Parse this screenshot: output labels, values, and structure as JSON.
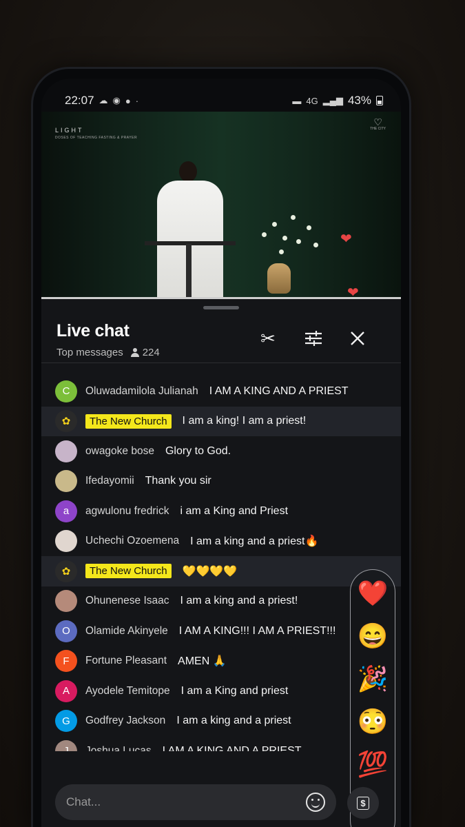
{
  "status": {
    "time": "22:07",
    "net": "4G",
    "battery": "43%"
  },
  "video": {
    "logo": "LIGHT",
    "logo_sub": "DOSES OF TEACHING FASTING & PRAYER",
    "corner_logo": "THE CITY"
  },
  "chat": {
    "title": "Live chat",
    "mode": "Top messages",
    "viewers": "224",
    "input_placeholder": "Chat...",
    "money_label": "$",
    "messages": [
      {
        "author": "Oluwadamilola Julianah",
        "text": "I AM A KING AND A PRIEST",
        "initial": "C",
        "color": "#7cbf3a",
        "owner": false
      },
      {
        "author": "The New Church",
        "text": "I am a king! I am a priest!",
        "initial": "✿",
        "color": "#2a2a2a",
        "owner": true
      },
      {
        "author": "owagoke bose",
        "text": "Glory to God.",
        "initial": "",
        "color": "#c7b4c9",
        "owner": false
      },
      {
        "author": "Ifedayomii",
        "text": "Thank you sir",
        "initial": "",
        "color": "#c9b98a",
        "owner": false
      },
      {
        "author": "agwulonu fredrick",
        "text": "i am a King and Priest",
        "initial": "a",
        "color": "#8e44c9",
        "owner": false
      },
      {
        "author": "Uchechi Ozoemena",
        "text": "I am a king and a priest🔥",
        "initial": "",
        "color": "#e0d6cf",
        "owner": false
      },
      {
        "author": "The New Church",
        "text": "💛💛💛💛",
        "initial": "✿",
        "color": "#2a2a2a",
        "owner": true
      },
      {
        "author": "Ohunenese Isaac",
        "text": "I am a king and a priest!",
        "initial": "",
        "color": "#b58a7a",
        "owner": false
      },
      {
        "author": "Olamide Akinyele",
        "text": "I AM A KING!!! I AM A PRIEST!!!",
        "initial": "O",
        "color": "#5c6bc0",
        "owner": false
      },
      {
        "author": "Fortune Pleasant",
        "text": "AMEN 🙏",
        "initial": "F",
        "color": "#f4511e",
        "owner": false
      },
      {
        "author": "Ayodele Temitope",
        "text": "I am a King and priest",
        "initial": "A",
        "color": "#d81b60",
        "owner": false
      },
      {
        "author": "Godfrey Jackson",
        "text": "I am a king and a priest",
        "initial": "G",
        "color": "#039be5",
        "owner": false
      },
      {
        "author": "Joshua Lucas",
        "text": "I AM A KING AND A PRIEST",
        "initial": "J",
        "color": "#a1887f",
        "owner": false
      }
    ],
    "reactions": [
      "❤️",
      "😄",
      "🎉",
      "😳",
      "💯"
    ]
  },
  "icons": {
    "clip": "scissors-icon",
    "settings": "sliders-icon",
    "close": "close-icon",
    "collapse": "chevron-down-icon"
  }
}
